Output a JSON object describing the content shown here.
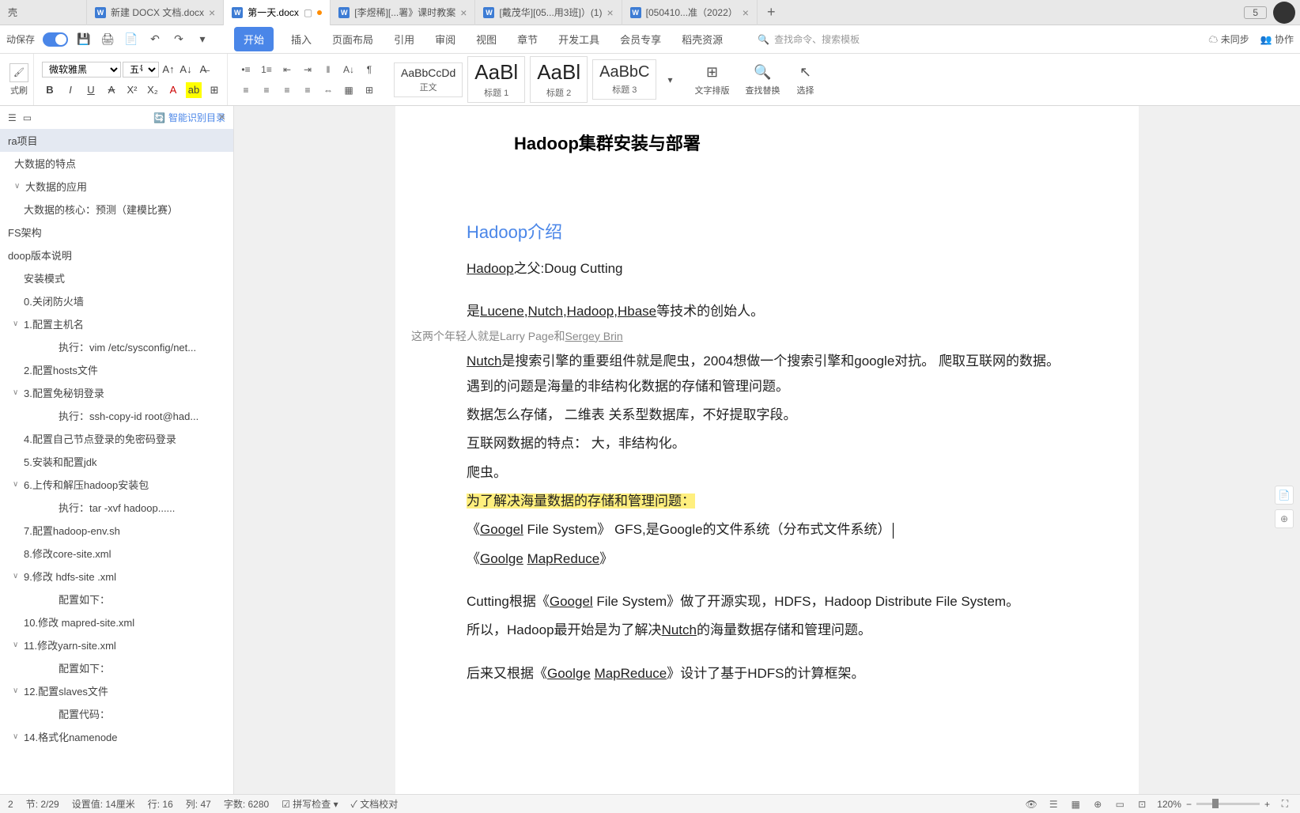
{
  "tabs": [
    {
      "label": "壳",
      "icon": ""
    },
    {
      "label": "新建 DOCX 文档.docx",
      "icon": "W"
    },
    {
      "label": "第一天.docx",
      "icon": "W",
      "active": true,
      "modified": true
    },
    {
      "label": "[李煜稀][...署》课时教案",
      "icon": "W"
    },
    {
      "label": "[戴茂华][05...用3班]）(1)",
      "icon": "W"
    },
    {
      "label": "[050410...准（2022）",
      "icon": "W"
    }
  ],
  "tab_count": "5",
  "quickbar": {
    "autosave": "动保存"
  },
  "menu": [
    "开始",
    "插入",
    "页面布局",
    "引用",
    "审阅",
    "视图",
    "章节",
    "开发工具",
    "会员专享",
    "稻壳资源"
  ],
  "search_placeholder": "查找命令、搜索模板",
  "right_tools": {
    "unsync": "未同步",
    "collab": "协作"
  },
  "font": {
    "name": "微软雅黑",
    "size": "五号"
  },
  "styles": [
    {
      "preview": "AaBbCcDd",
      "name": "正文",
      "size": "sm"
    },
    {
      "preview": "AaBl",
      "name": "标题 1",
      "size": "lg"
    },
    {
      "preview": "AaBl",
      "name": "标题 2",
      "size": "lg"
    },
    {
      "preview": "AaBbC",
      "name": "标题 3",
      "size": "md"
    }
  ],
  "ribbon_tools": {
    "layout": "文字排版",
    "find": "查找替换",
    "select": "选择"
  },
  "brush_label": "式刷",
  "sidebar": {
    "smart_toc": "智能识别目录",
    "items": [
      {
        "t": "ra项目",
        "cls": "sel"
      },
      {
        "t": "大数据的特点",
        "cls": "ind1"
      },
      {
        "t": "大数据的应用",
        "cls": "ind1",
        "chev": "∨"
      },
      {
        "t": "大数据的核心：预测（建模比赛）",
        "cls": "ind2"
      },
      {
        "t": "FS架构",
        "cls": ""
      },
      {
        "t": "doop版本说明",
        "cls": ""
      },
      {
        "t": "安装模式",
        "cls": "ind2"
      },
      {
        "t": "0.关闭防火墙",
        "cls": "ind2"
      },
      {
        "t": "1.配置主机名",
        "cls": "ind2",
        "chev": "∨"
      },
      {
        "t": "执行：vim /etc/sysconfig/net...",
        "cls": "ind3"
      },
      {
        "t": "2.配置hosts文件",
        "cls": "ind2"
      },
      {
        "t": "3.配置免秘钥登录",
        "cls": "ind2",
        "chev": "∨"
      },
      {
        "t": "执行：ssh-copy-id root@had...",
        "cls": "ind3"
      },
      {
        "t": "4.配置自己节点登录的免密码登录",
        "cls": "ind2"
      },
      {
        "t": "5.安装和配置jdk",
        "cls": "ind2"
      },
      {
        "t": "6.上传和解压hadoop安装包",
        "cls": "ind2",
        "chev": "∨"
      },
      {
        "t": "执行：tar -xvf   hadoop......",
        "cls": "ind3"
      },
      {
        "t": "7.配置hadoop-env.sh",
        "cls": "ind2"
      },
      {
        "t": "8.修改core-site.xml",
        "cls": "ind2"
      },
      {
        "t": "9.修改 hdfs-site .xml",
        "cls": "ind2",
        "chev": "∨"
      },
      {
        "t": "配置如下：",
        "cls": "ind3"
      },
      {
        "t": "10.修改 mapred-site.xml",
        "cls": "ind2"
      },
      {
        "t": "11.修改yarn-site.xml",
        "cls": "ind2",
        "chev": "∨"
      },
      {
        "t": "配置如下：",
        "cls": "ind3"
      },
      {
        "t": "12.配置slaves文件",
        "cls": "ind2",
        "chev": "∨"
      },
      {
        "t": "配置代码：",
        "cls": "ind3"
      },
      {
        "t": "14.格式化namenode",
        "cls": "ind2",
        "chev": "∨"
      }
    ]
  },
  "doc": {
    "title": "Hadoop集群安装与部署",
    "h2": "Hadoop介绍",
    "p1_a": "Hadoop",
    "p1_b": "之父:Doug  Cutting",
    "p2_a": "是",
    "p2_b": "Lucene",
    "p2_c": ",",
    "p2_d": "Nutch",
    "p2_e": ",",
    "p2_f": "Hadoop",
    "p2_g": ",",
    "p2_h": "Hbase",
    "p2_i": "等技术的创始人。",
    "note": "这两个年轻人就是Larry Page和",
    "note_u": "Sergey Brin",
    "p3_a": "Nutch",
    "p3_b": "是搜索引擎的重要组件就是爬虫，2004想做一个搜索引擎和google对抗。  爬取互联网的数据。遇到的问题是海量的非结构化数据的存储和管理问题。",
    "p4": "数据怎么存储，  二维表 关系型数据库，不好提取字段。",
    "p5": "互联网数据的特点：  大，非结构化。",
    "p6": "爬虫。",
    "p7": "为了解决海量数据的存储和管理问题：",
    "p8_a": "《",
    "p8_b": "Googel",
    "p8_c": "  File  System》  GFS,是Google的文件系统（分布式文件系统）",
    "p9_a": "《",
    "p9_b": "Goolge",
    "p9_c": "  ",
    "p9_d": "MapReduce",
    "p9_e": "》",
    "p10_a": "Cutting根据《",
    "p10_b": "Googel",
    "p10_c": "  File  System》做了开源实现，HDFS，Hadoop  Distribute  File  System。",
    "p11_a": "所以，Hadoop最开始是为了解决",
    "p11_b": "Nutch",
    "p11_c": "的海量数据存储和管理问题。",
    "p12_a": "后来又根据《",
    "p12_b": "Goolge",
    "p12_c": " ",
    "p12_d": "MapReduce",
    "p12_e": "》设计了基于HDFS的计算框架。"
  },
  "status": {
    "page": "2",
    "section": "节: 2/29",
    "setting": "设置值: 14厘米",
    "line": "行: 16",
    "col": "列: 47",
    "words": "字数: 6280",
    "spell": "拼写检查",
    "proof": "文档校对",
    "zoom": "120%"
  }
}
